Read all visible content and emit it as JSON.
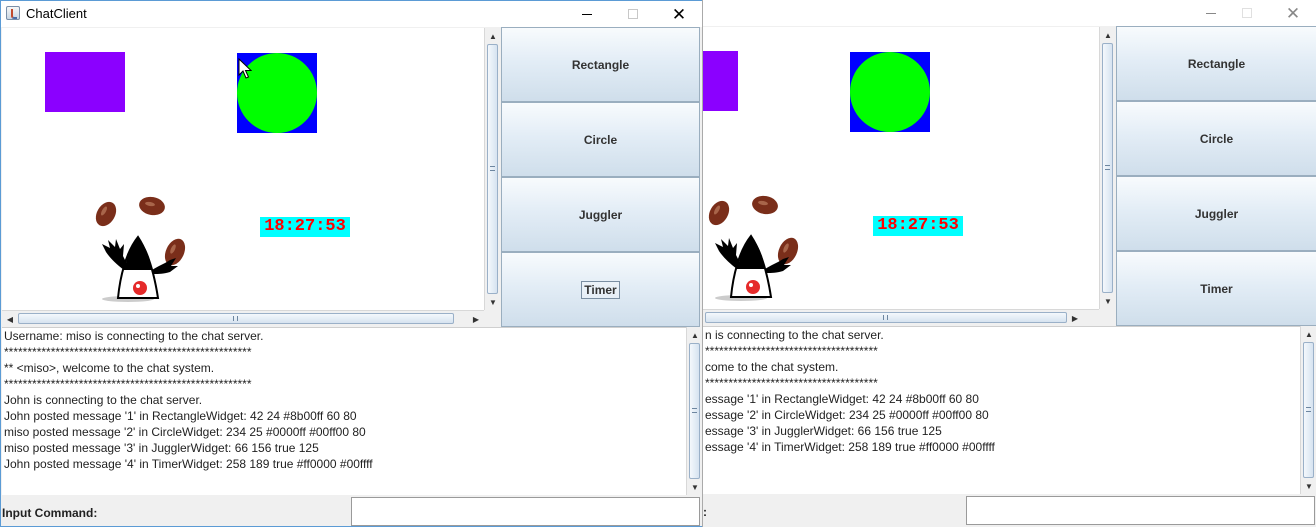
{
  "window": {
    "title": "ChatClient",
    "title_icon": "java-coffee-cup-icon",
    "minimize_icon": "minimize-icon",
    "maximize_icon": "maximize-icon",
    "close_icon": "close-icon"
  },
  "widgets": {
    "rectangle": {
      "label": "RectangleWidget",
      "color": "#8b00ff"
    },
    "circle": {
      "label": "CircleWidget",
      "background": "#0000ff",
      "fill": "#00ff00"
    },
    "juggler": {
      "label": "JugglerWidget",
      "icon": "duke-juggler-icon"
    },
    "timer": {
      "time": "18:27:53",
      "color": "#ff0000",
      "background": "#00ffff"
    }
  },
  "buttons": {
    "rectangle": "Rectangle",
    "circle": "Circle",
    "juggler": "Juggler",
    "timer": "Timer"
  },
  "left_client": {
    "log": [
      "Username: miso is connecting to the chat server.",
      "*****************************************************",
      "** <miso>, welcome to the chat system.",
      "*****************************************************",
      "John is connecting to the chat server.",
      "John posted message '1' in RectangleWidget: 42 24 #8b00ff 60 80",
      "miso posted message '2' in CircleWidget: 234 25 #0000ff #00ff00 80",
      "miso posted message '3' in JugglerWidget: 66 156 true 125",
      "John posted message '4' in TimerWidget: 258 189 true #ff0000 #00ffff"
    ],
    "input_label": "Input Command:",
    "input_value": ""
  },
  "right_client": {
    "log": [
      "n is connecting to the chat server.",
      "*************************************",
      "come to the chat system.",
      "*************************************",
      "essage '1' in RectangleWidget: 42 24 #8b00ff 60 80",
      "essage '2' in CircleWidget: 234 25 #0000ff #00ff00 80",
      "essage '3' in JugglerWidget: 66 156 true 125",
      "essage '4' in TimerWidget: 258 189 true #ff0000 #00ffff"
    ],
    "input_label": ":",
    "input_value": ""
  },
  "colors": {
    "button_gradient_top": "#f8fbfd",
    "button_gradient_bottom": "#cfdeeb",
    "scroll_thumb": "#d6e3f0",
    "window_border": "#5b9bd5"
  }
}
